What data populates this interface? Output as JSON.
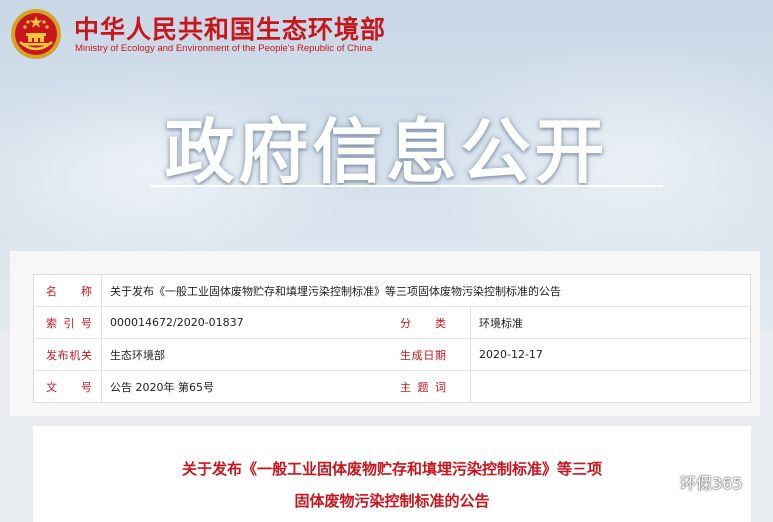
{
  "header": {
    "org_cn": "中华人民共和国生态环境部",
    "org_en": "Ministry of Ecology and Environment of the People's Republic of China",
    "banner": "政府信息公开",
    "brand_color": "#c8161d"
  },
  "meta": {
    "name_label": "名　称",
    "name_value": "关于发布《一般工业固体废物贮存和填埋污染控制标准》等三项固体废物污染控制标准的公告",
    "index_label": "索引号",
    "index_value": "000014672/2020-01837",
    "category_label": "分　类",
    "category_value": "环境标准",
    "issuer_label": "发布机关",
    "issuer_value": "生态环境部",
    "date_label": "生成日期",
    "date_value": "2020-12-17",
    "docno_label": "文　号",
    "docno_value": "公告 2020年 第65号",
    "topic_label": "主题词",
    "topic_value": ""
  },
  "article": {
    "title_line1": "关于发布《一般工业固体废物贮存和填埋污染控制标准》等三项",
    "title_line2": "固体废物污染控制标准的公告"
  },
  "watermark": {
    "icon": "wechat-icon",
    "text": "环保365"
  }
}
